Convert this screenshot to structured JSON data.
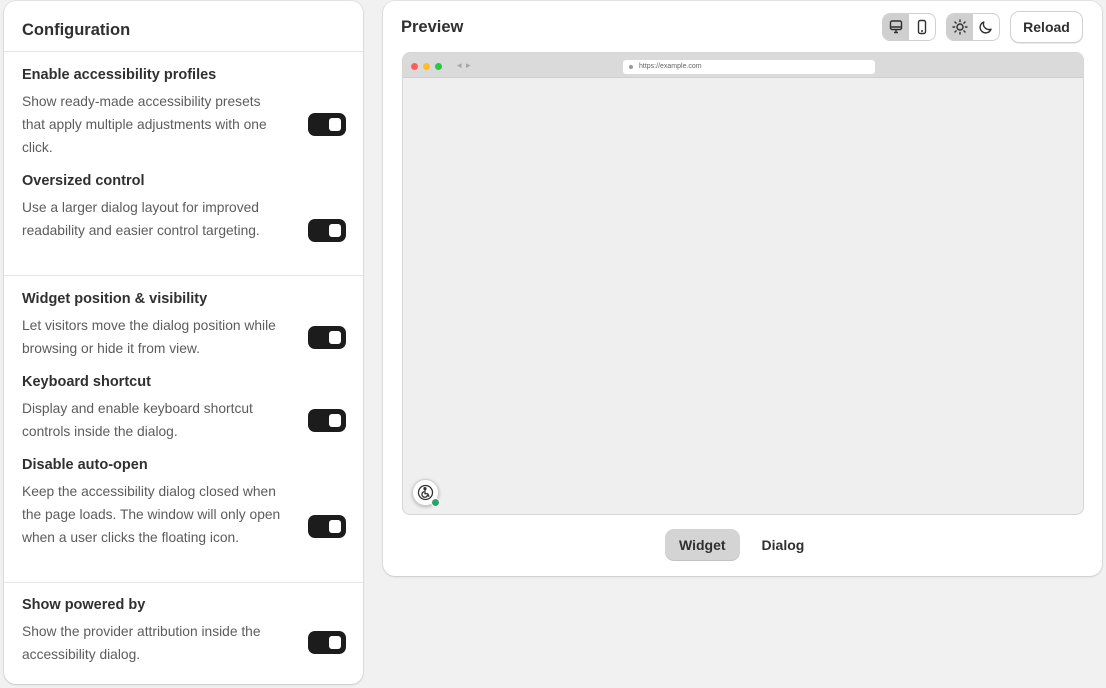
{
  "config": {
    "title": "Configuration",
    "groups": [
      {
        "settings": [
          {
            "title": "Enable accessibility profiles",
            "description": "Show ready-made accessibility presets that apply multiple adjustments with one click.",
            "enabled": true
          },
          {
            "title": "Oversized control",
            "description": "Use a larger dialog layout for improved readability and easier control targeting.",
            "enabled": true
          }
        ]
      },
      {
        "settings": [
          {
            "title": "Widget position & visibility",
            "description": "Let visitors move the dialog position while browsing or hide it from view.",
            "enabled": true
          },
          {
            "title": "Keyboard shortcut",
            "description": "Display and enable keyboard shortcut controls inside the dialog.",
            "enabled": true
          },
          {
            "title": "Disable auto-open",
            "description": "Keep the accessibility dialog closed when the page loads. The window will only open when a user clicks the floating icon.",
            "enabled": true
          }
        ]
      },
      {
        "settings": [
          {
            "title": "Show powered by",
            "description": "Show the provider attribution inside the accessibility dialog.",
            "enabled": true
          }
        ]
      }
    ]
  },
  "preview": {
    "title": "Preview",
    "device_toggle": {
      "selected": "desktop",
      "options": [
        "desktop-icon",
        "mobile-icon"
      ]
    },
    "theme_toggle": {
      "selected": "light",
      "options": [
        "sun-icon",
        "moon-icon"
      ]
    },
    "reload_label": "Reload",
    "browser": {
      "url": "https://example.com",
      "traffic_light_colors": [
        "#ff5f57",
        "#febc2e",
        "#28c840"
      ]
    },
    "widget_icon": "accessibility-icon",
    "tabs": [
      {
        "label": "Widget",
        "active": true
      },
      {
        "label": "Dialog",
        "active": false
      }
    ]
  },
  "colors": {
    "toggle_on": "#1c1c1c",
    "badge": "#29a36a"
  }
}
